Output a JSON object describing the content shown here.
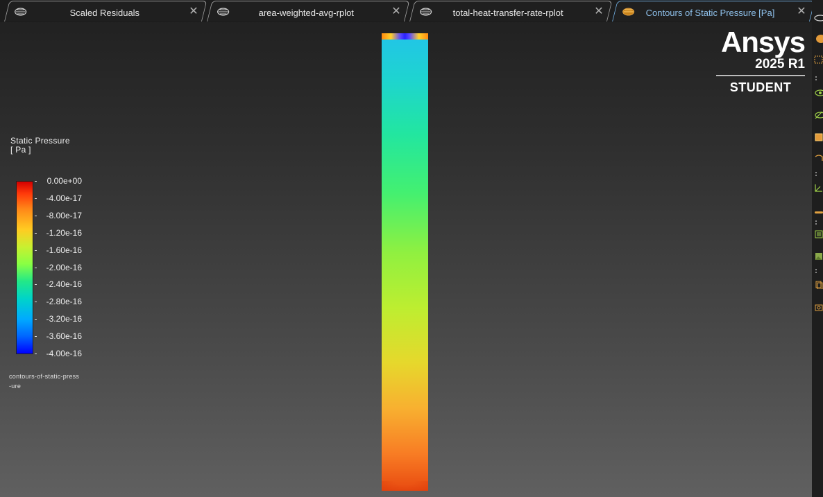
{
  "tabs": [
    {
      "label": "Scaled Residuals",
      "active": false,
      "icon": "plot-icon"
    },
    {
      "label": "area-weighted-avg-rplot",
      "active": false,
      "icon": "plot-icon"
    },
    {
      "label": "total-heat-transfer-rate-rplot",
      "active": false,
      "icon": "plot-icon"
    },
    {
      "label": "Contours of Static Pressure [Pa]",
      "active": true,
      "icon": "contour-icon"
    }
  ],
  "tab_close_symbol": "✕",
  "legend": {
    "title_line1": "Static Pressure",
    "title_line2": "[ Pa ]",
    "ticks": [
      "0.00e+00",
      "-4.00e-17",
      "-8.00e-17",
      "-1.20e-16",
      "-1.60e-16",
      "-2.00e-16",
      "-2.40e-16",
      "-2.80e-16",
      "-3.20e-16",
      "-3.60e-16",
      "-4.00e-16"
    ],
    "contour_name_line1": "contours-of-static-press",
    "contour_name_line2": "-ure"
  },
  "logo": {
    "name": "Ansys",
    "version": "2025 R1",
    "edition": "STUDENT"
  },
  "colors": {
    "active_tab_text": "#8ec0ea",
    "colormap_min": "#0000ff",
    "colormap_max": "#d40000"
  },
  "right_toolbar": [
    "ellipse-icon",
    "orange-disc-icon",
    "dotted-region-icon",
    "eye-icon",
    "hidden-eye-icon",
    "box-icon",
    "rotate-icon",
    "axes-icon",
    "line-icon",
    "list-icon",
    "image-icon",
    "copy-icon",
    "camera-icon"
  ]
}
